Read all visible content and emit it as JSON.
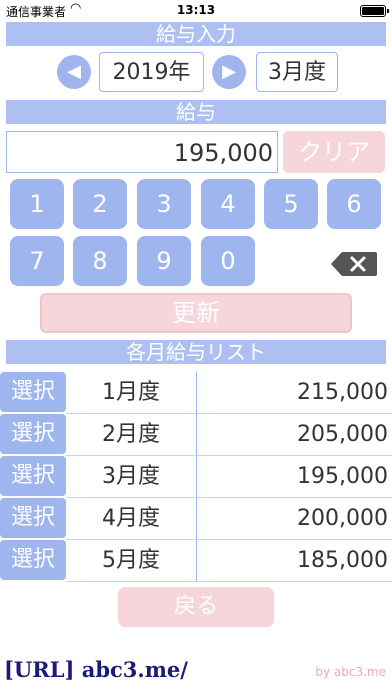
{
  "status_bar": {
    "carrier": "通信事業者",
    "time": "13:13"
  },
  "header": {
    "title": "給与入力"
  },
  "period": {
    "year": "2019年",
    "month": "3月度"
  },
  "salary": {
    "label": "給与",
    "value": "195,000",
    "clear_label": "クリア"
  },
  "keypad": {
    "keys": [
      "1",
      "2",
      "3",
      "4",
      "5",
      "6",
      "7",
      "8",
      "9",
      "0"
    ]
  },
  "update_label": "更新",
  "list": {
    "title": "各月給与リスト",
    "select_label": "選択",
    "rows": [
      {
        "month": "1月度",
        "amount": "215,000"
      },
      {
        "month": "2月度",
        "amount": "205,000"
      },
      {
        "month": "3月度",
        "amount": "195,000"
      },
      {
        "month": "4月度",
        "amount": "200,000"
      },
      {
        "month": "5月度",
        "amount": "185,000"
      }
    ]
  },
  "back_label": "戻る",
  "footer": {
    "url": "[URL] abc3.me/",
    "credit": "by abc3.me"
  },
  "icons": {
    "prev": "chevron-left-icon",
    "next": "chevron-right-icon",
    "backspace": "backspace-icon",
    "wifi": "wifi-icon",
    "battery": "battery-icon"
  },
  "colors": {
    "accent": "#9fb5ee",
    "header": "#aec0f2",
    "disabled_button": "#f7d6db",
    "url": "#1a1a7a",
    "credit": "#f3a9b4"
  }
}
